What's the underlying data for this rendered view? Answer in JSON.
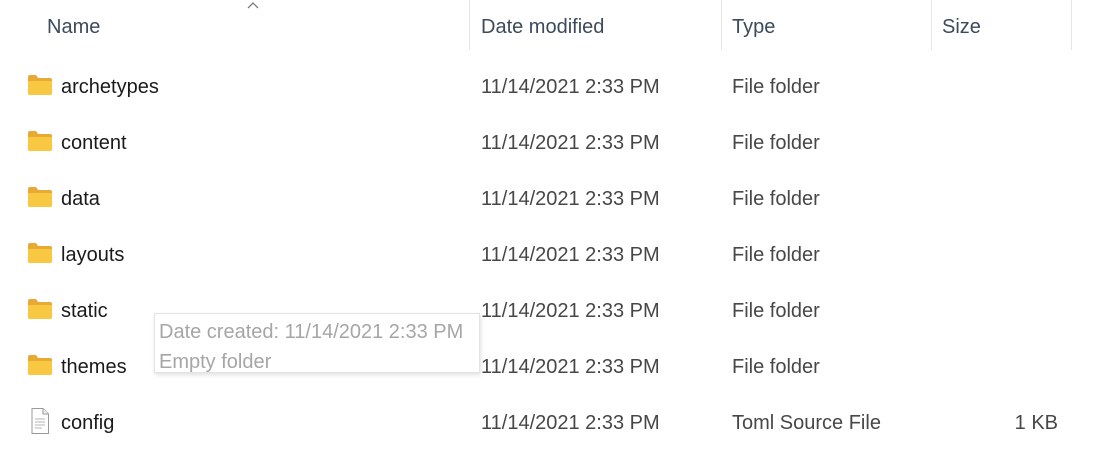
{
  "columns": {
    "name": "Name",
    "date_modified": "Date modified",
    "type": "Type",
    "size": "Size"
  },
  "sort": {
    "column": "name",
    "icon": "sort-ascending-chevron-icon"
  },
  "items": [
    {
      "name": "archetypes",
      "date": "11/14/2021 2:33 PM",
      "type": "File folder",
      "size": "",
      "icon": "folder-icon"
    },
    {
      "name": "content",
      "date": "11/14/2021 2:33 PM",
      "type": "File folder",
      "size": "",
      "icon": "folder-icon"
    },
    {
      "name": "data",
      "date": "11/14/2021 2:33 PM",
      "type": "File folder",
      "size": "",
      "icon": "folder-icon"
    },
    {
      "name": "layouts",
      "date": "11/14/2021 2:33 PM",
      "type": "File folder",
      "size": "",
      "icon": "folder-icon"
    },
    {
      "name": "static",
      "date": "11/14/2021 2:33 PM",
      "type": "File folder",
      "size": "",
      "icon": "folder-icon"
    },
    {
      "name": "themes",
      "date": "11/14/2021 2:33 PM",
      "type": "File folder",
      "size": "",
      "icon": "folder-icon"
    },
    {
      "name": "config",
      "date": "11/14/2021 2:33 PM",
      "type": "Toml Source File",
      "size": "1 KB",
      "icon": "document-file-icon"
    }
  ],
  "tooltip": {
    "line1": "Date created: 11/14/2021 2:33 PM",
    "line2": "Empty folder"
  },
  "colors": {
    "folder": "#f8c843",
    "folder_shade": "#e8a935",
    "header_text": "#3c4a5c"
  }
}
